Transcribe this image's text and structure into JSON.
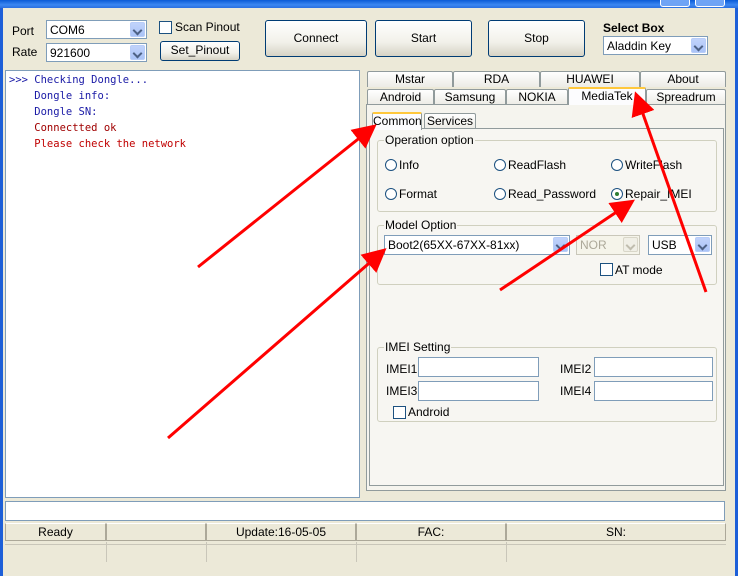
{
  "top": {
    "port_label": "Port",
    "port_value": "COM6",
    "rate_label": "Rate",
    "rate_value": "921600",
    "scan_pinout_label": "Scan Pinout",
    "set_pinout_label": "Set_Pinout",
    "connect_label": "Connect",
    "start_label": "Start",
    "stop_label": "Stop",
    "select_box_label": "Select Box",
    "select_box_value": "Aladdin Key"
  },
  "log": [
    {
      "text": ">>> Checking Dongle...",
      "color": "#1a1aa6"
    },
    {
      "text": "    Dongle info:",
      "color": "#1a1aa6"
    },
    {
      "text": "    Dongle SN:",
      "color": "#1a1aa6"
    },
    {
      "text": "    Connectted ok",
      "color": "#a00000"
    },
    {
      "text": "    Please check the network",
      "color": "#c00000"
    }
  ],
  "tabs_row1": [
    "Mstar",
    "RDA",
    "HUAWEI",
    "About"
  ],
  "tabs_row2": [
    "Android",
    "Samsung",
    "NOKIA",
    "MediaTek",
    "Spreadrum"
  ],
  "subtabs": [
    "Common",
    "Services"
  ],
  "operation": {
    "title": "Operation option",
    "options": [
      "Info",
      "ReadFlash",
      "WriteFlash",
      "Format",
      "Read_Password",
      "Repair_IMEI"
    ],
    "selected": "Repair_IMEI"
  },
  "model": {
    "title": "Model Option",
    "model_value": "Boot2(65XX-67XX-81xx)",
    "memory_value": "NOR",
    "conn_value": "USB",
    "at_mode_label": "AT mode"
  },
  "imei": {
    "title": "IMEI Setting",
    "imei1_label": "IMEI1",
    "imei2_label": "IMEI2",
    "imei3_label": "IMEI3",
    "imei4_label": "IMEI4",
    "android_label": "Android"
  },
  "statusbar": {
    "ready": "Ready",
    "update": "Update:16-05-05",
    "fac": "FAC:",
    "sn": "SN:"
  },
  "colors": {
    "annotation_arrow": "#ff0000",
    "log_blue": "#1a1aa6",
    "log_red": "#c00000",
    "active_tab_highlight": "#ffc83c"
  },
  "icons": [
    "chevron-down-icon",
    "radio-selected-icon",
    "annotation-arrow-icon"
  ]
}
